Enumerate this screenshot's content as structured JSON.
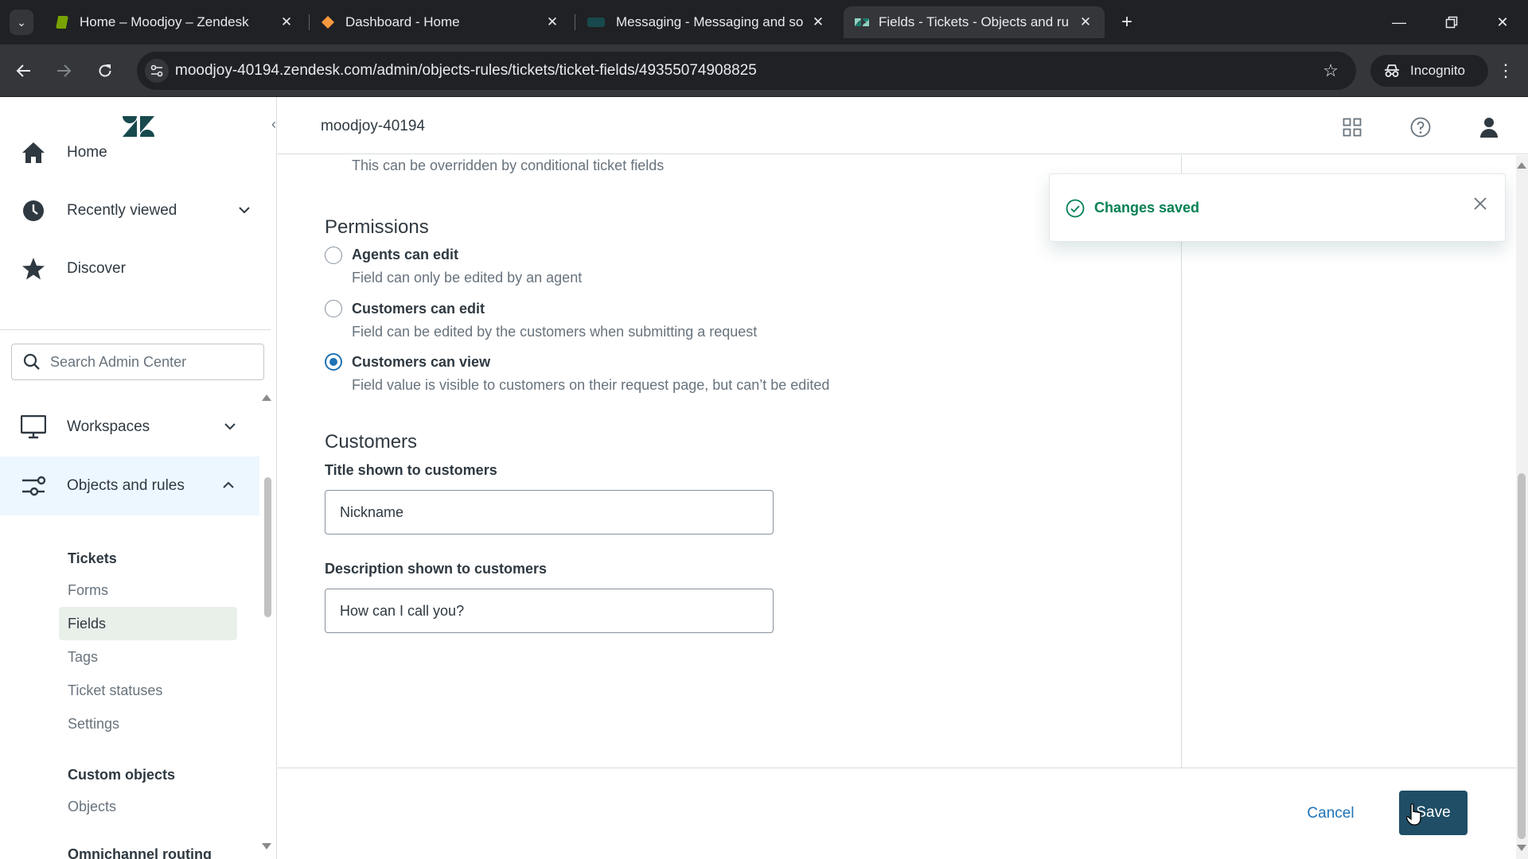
{
  "browser": {
    "tabs": [
      {
        "title": "Home – Moodjoy – Zendesk",
        "favicon": "zendesk-green-icon",
        "color": "#78a300"
      },
      {
        "title": "Dashboard - Home",
        "favicon": "dashboard-orange-icon",
        "color": "#f79a3e"
      },
      {
        "title": "Messaging - Messaging and so",
        "favicon": "messaging-icon",
        "color": "#17494d"
      },
      {
        "title": "Fields - Tickets - Objects and ru",
        "favicon": "zendesk-icon",
        "color": "#17494d"
      }
    ],
    "active_tab": 3,
    "url": "moodjoy-40194.zendesk.com/admin/objects-rules/tickets/ticket-fields/49355074908825",
    "incognito_label": "Incognito"
  },
  "header": {
    "account": "moodjoy-40194"
  },
  "sidebar": {
    "nav": {
      "home": "Home",
      "recent": "Recently viewed",
      "discover": "Discover",
      "workspaces": "Workspaces",
      "objects": "Objects and rules"
    },
    "search_placeholder": "Search Admin Center",
    "tickets_heading": "Tickets",
    "tickets_items": [
      "Forms",
      "Fields",
      "Tags",
      "Ticket statuses",
      "Settings"
    ],
    "selected_item": "Fields",
    "custom_heading": "Custom objects",
    "custom_items": [
      "Objects"
    ],
    "next_heading": "Omnichannel routing"
  },
  "main": {
    "hint": "This can be overridden by conditional ticket fields",
    "permissions": {
      "heading": "Permissions",
      "options": [
        {
          "label": "Agents can edit",
          "desc": "Field can only be edited by an agent",
          "selected": false
        },
        {
          "label": "Customers can edit",
          "desc": "Field can be edited by the customers when submitting a request",
          "selected": false
        },
        {
          "label": "Customers can view",
          "desc": "Field value is visible to customers on their request page, but can’t be edited",
          "selected": true
        }
      ]
    },
    "customers": {
      "heading": "Customers",
      "title_label": "Title shown to customers",
      "title_value": "Nickname",
      "desc_label": "Description shown to customers",
      "desc_value": "How can I call you?"
    }
  },
  "toast": {
    "message": "Changes saved",
    "color": "#038153"
  },
  "footer": {
    "cancel": "Cancel",
    "save": "Save"
  },
  "colors": {
    "primary": "#1f73b7",
    "save_button": "#1f4e66",
    "nav_active": "#edf7ff",
    "selected_item": "#e9f0ea"
  }
}
